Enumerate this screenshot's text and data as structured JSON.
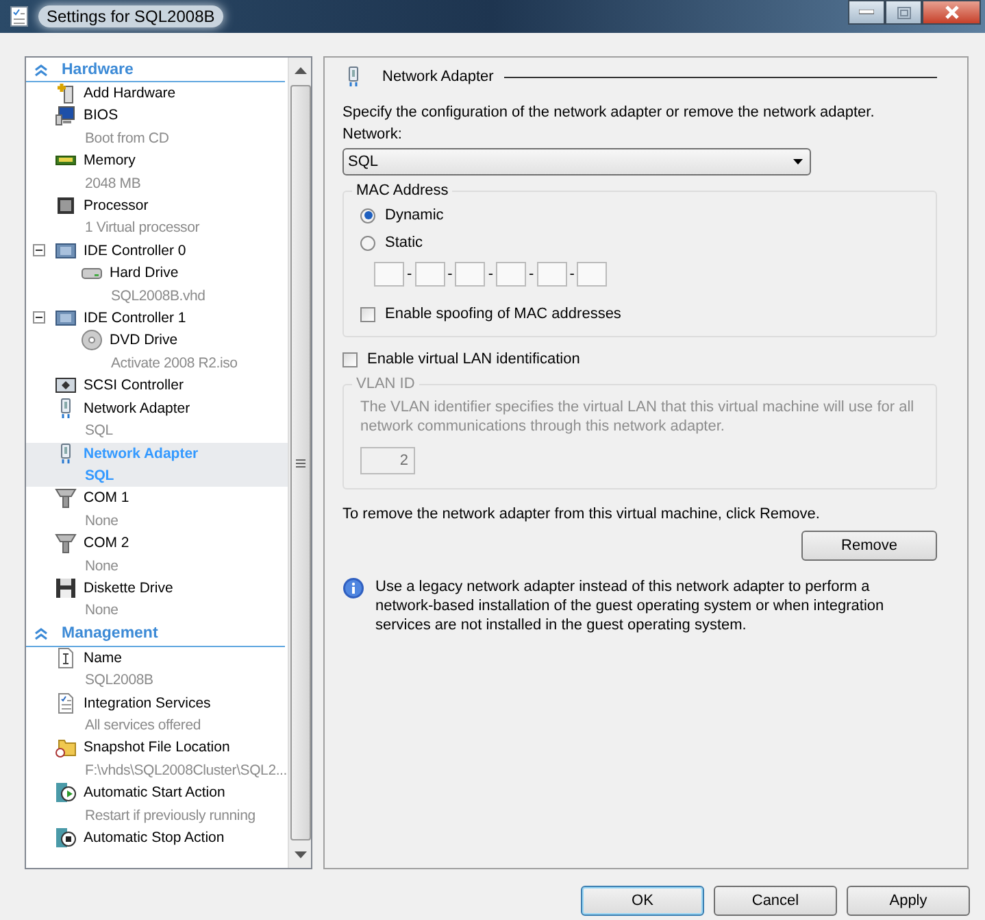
{
  "window": {
    "title": "Settings for SQL2008B"
  },
  "sidebar": {
    "sections": [
      {
        "heading": "Hardware",
        "items": [
          {
            "kind": "add-hardware",
            "label": "Add Hardware",
            "selected": false
          },
          {
            "kind": "bios",
            "label": "BIOS",
            "detail": "Boot from CD",
            "selected": false
          },
          {
            "kind": "memory",
            "label": "Memory",
            "detail": "2048 MB",
            "selected": false
          },
          {
            "kind": "processor",
            "label": "Processor",
            "detail": "1 Virtual processor",
            "selected": false
          },
          {
            "kind": "ide",
            "label": "IDE Controller 0",
            "selected": false,
            "expanded": true,
            "children": [
              {
                "kind": "hard-drive",
                "label": "Hard Drive",
                "detail": "SQL2008B.vhd",
                "selected": false
              }
            ]
          },
          {
            "kind": "ide",
            "label": "IDE Controller 1",
            "selected": false,
            "expanded": true,
            "children": [
              {
                "kind": "dvd",
                "label": "DVD Drive",
                "detail": "Activate 2008 R2.iso",
                "selected": false
              }
            ]
          },
          {
            "kind": "scsi",
            "label": "SCSI Controller",
            "selected": false
          },
          {
            "kind": "network",
            "label": "Network Adapter",
            "detail": "SQL",
            "selected": false
          },
          {
            "kind": "network",
            "label": "Network Adapter",
            "detail": "SQL",
            "selected": true
          },
          {
            "kind": "com",
            "label": "COM 1",
            "detail": "None",
            "selected": false
          },
          {
            "kind": "com",
            "label": "COM 2",
            "detail": "None",
            "selected": false
          },
          {
            "kind": "diskette",
            "label": "Diskette Drive",
            "detail": "None",
            "selected": false
          }
        ]
      },
      {
        "heading": "Management",
        "items": [
          {
            "kind": "name",
            "label": "Name",
            "detail": "SQL2008B",
            "selected": false
          },
          {
            "kind": "integration",
            "label": "Integration Services",
            "detail": "All services offered",
            "selected": false
          },
          {
            "kind": "snapshot",
            "label": "Snapshot File Location",
            "detail": "F:\\vhds\\SQL2008Cluster\\SQL2...",
            "selected": false
          },
          {
            "kind": "start",
            "label": "Automatic Start Action",
            "detail": "Restart if previously running",
            "selected": false
          },
          {
            "kind": "stop",
            "label": "Automatic Stop Action",
            "selected": false
          }
        ]
      }
    ]
  },
  "panel": {
    "title": "Network Adapter",
    "description": "Specify the configuration of the network adapter or remove the network adapter.",
    "network": {
      "label": "Network:",
      "value": "SQL"
    },
    "mac_address": {
      "legend": "MAC Address",
      "options": [
        {
          "label": "Dynamic",
          "selected": true
        },
        {
          "label": "Static",
          "selected": false
        }
      ],
      "separators": [
        "-",
        "-",
        "-",
        "-",
        "-"
      ],
      "spoofing": {
        "label": "Enable spoofing of MAC addresses",
        "checked": false
      }
    },
    "vlan": {
      "label": "Enable virtual LAN identification",
      "checked": false
    },
    "vlan_id": {
      "legend": "VLAN ID",
      "description": "The VLAN identifier specifies the virtual LAN that this virtual machine will use for all network communications through this network adapter.",
      "value": "2",
      "disabled": true
    },
    "remove_text": "To remove the network adapter from this virtual machine, click Remove.",
    "remove_button": "Remove",
    "info_text": "Use a legacy network adapter instead of this network adapter to perform a network-based installation of the guest operating system or when integration services are not installed in the guest operating system."
  },
  "buttons": [
    {
      "label": "OK",
      "default": true
    },
    {
      "label": "Cancel",
      "default": false
    },
    {
      "label": "Apply",
      "default": false
    }
  ]
}
